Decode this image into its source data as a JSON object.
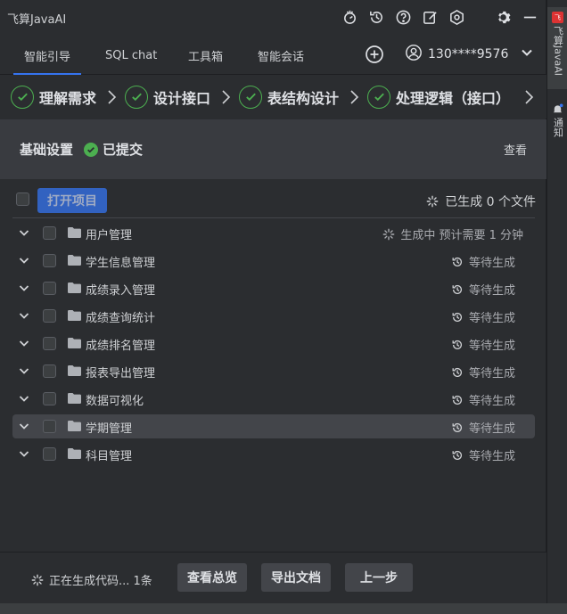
{
  "app": {
    "title": "飞算JavaAI"
  },
  "titlebar_icons": [
    "plugin-icon",
    "history-icon",
    "help-icon",
    "edit-icon",
    "settings-hex-icon"
  ],
  "tabs": [
    {
      "label": "智能引导",
      "active": true
    },
    {
      "label": "SQL chat",
      "active": false
    },
    {
      "label": "工具箱",
      "active": false
    },
    {
      "label": "智能会话",
      "active": false
    }
  ],
  "account": {
    "phone": "130****9576"
  },
  "steps": [
    {
      "label": "理解需求"
    },
    {
      "label": "设计接口"
    },
    {
      "label": "表结构设计"
    },
    {
      "label": "处理逻辑（接口）"
    }
  ],
  "basic": {
    "title": "基础设置",
    "status": "已提交",
    "view_label": "查看"
  },
  "list": {
    "open_project_label": "打开项目",
    "generated_summary": "已生成 0 个文件",
    "items": [
      {
        "name": "用户管理",
        "status": "生成中  预计需要 1 分钟",
        "state": "generating"
      },
      {
        "name": "学生信息管理",
        "status": "等待生成",
        "state": "waiting"
      },
      {
        "name": "成绩录入管理",
        "status": "等待生成",
        "state": "waiting"
      },
      {
        "name": "成绩查询统计",
        "status": "等待生成",
        "state": "waiting"
      },
      {
        "name": "成绩排名管理",
        "status": "等待生成",
        "state": "waiting"
      },
      {
        "name": "报表导出管理",
        "status": "等待生成",
        "state": "waiting"
      },
      {
        "name": "数据可视化",
        "status": "等待生成",
        "state": "waiting"
      },
      {
        "name": "学期管理",
        "status": "等待生成",
        "state": "waiting",
        "selected": true
      },
      {
        "name": "科目管理",
        "status": "等待生成",
        "state": "waiting"
      }
    ]
  },
  "footer": {
    "generating_text": "正在生成代码... 1条",
    "overview_label": "查看总览",
    "export_label": "导出文档",
    "prev_label": "上一步"
  },
  "sidestrip": {
    "tool1_label": "飞算JavaAI",
    "tool2_label": "通知"
  },
  "colors": {
    "accent": "#3574f0",
    "success": "#4caf50",
    "background": "#2b2d30"
  }
}
